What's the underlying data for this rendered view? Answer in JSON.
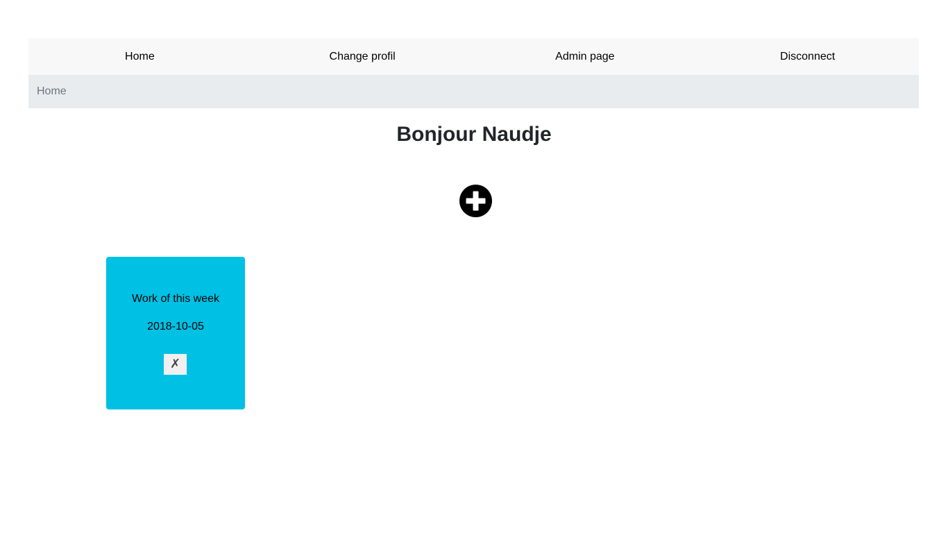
{
  "nav": {
    "items": [
      {
        "label": "Home"
      },
      {
        "label": "Change profil"
      },
      {
        "label": "Admin page"
      },
      {
        "label": "Disconnect"
      }
    ]
  },
  "breadcrumb": {
    "items": [
      {
        "label": "Home"
      }
    ]
  },
  "main": {
    "title": "Bonjour Naudje",
    "add_button_icon": "plus-circle-icon"
  },
  "cards": [
    {
      "title": "Work of this week",
      "date": "2018-10-05",
      "delete_label": "✗",
      "color": "#00c0e4"
    }
  ]
}
